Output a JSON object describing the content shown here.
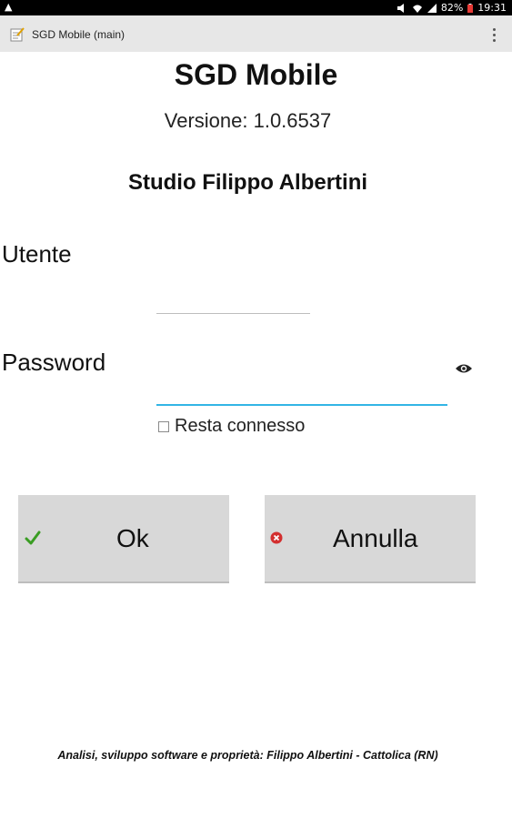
{
  "status_bar": {
    "warning_icon": "warning-icon",
    "battery": "82%",
    "time": "19:31"
  },
  "title_bar": {
    "title": "SGD Mobile (main)",
    "menu_icon": "overflow-menu-icon"
  },
  "header": {
    "app_name": "SGD Mobile",
    "version": "Versione: 1.0.6537",
    "studio": "Studio Filippo Albertini"
  },
  "form": {
    "user_label": "Utente",
    "user_value": "",
    "password_label": "Password",
    "password_value": "",
    "remember_label": "Resta connesso",
    "remember_checked": false
  },
  "buttons": {
    "ok": "Ok",
    "cancel": "Annulla"
  },
  "footer": {
    "text": "Analisi, sviluppo software e proprietà: Filippo Albertini - Cattolica (RN)"
  },
  "colors": {
    "accent": "#33b5e5",
    "ok_icon": "#3a9d23",
    "cancel_icon": "#d32f2f"
  }
}
